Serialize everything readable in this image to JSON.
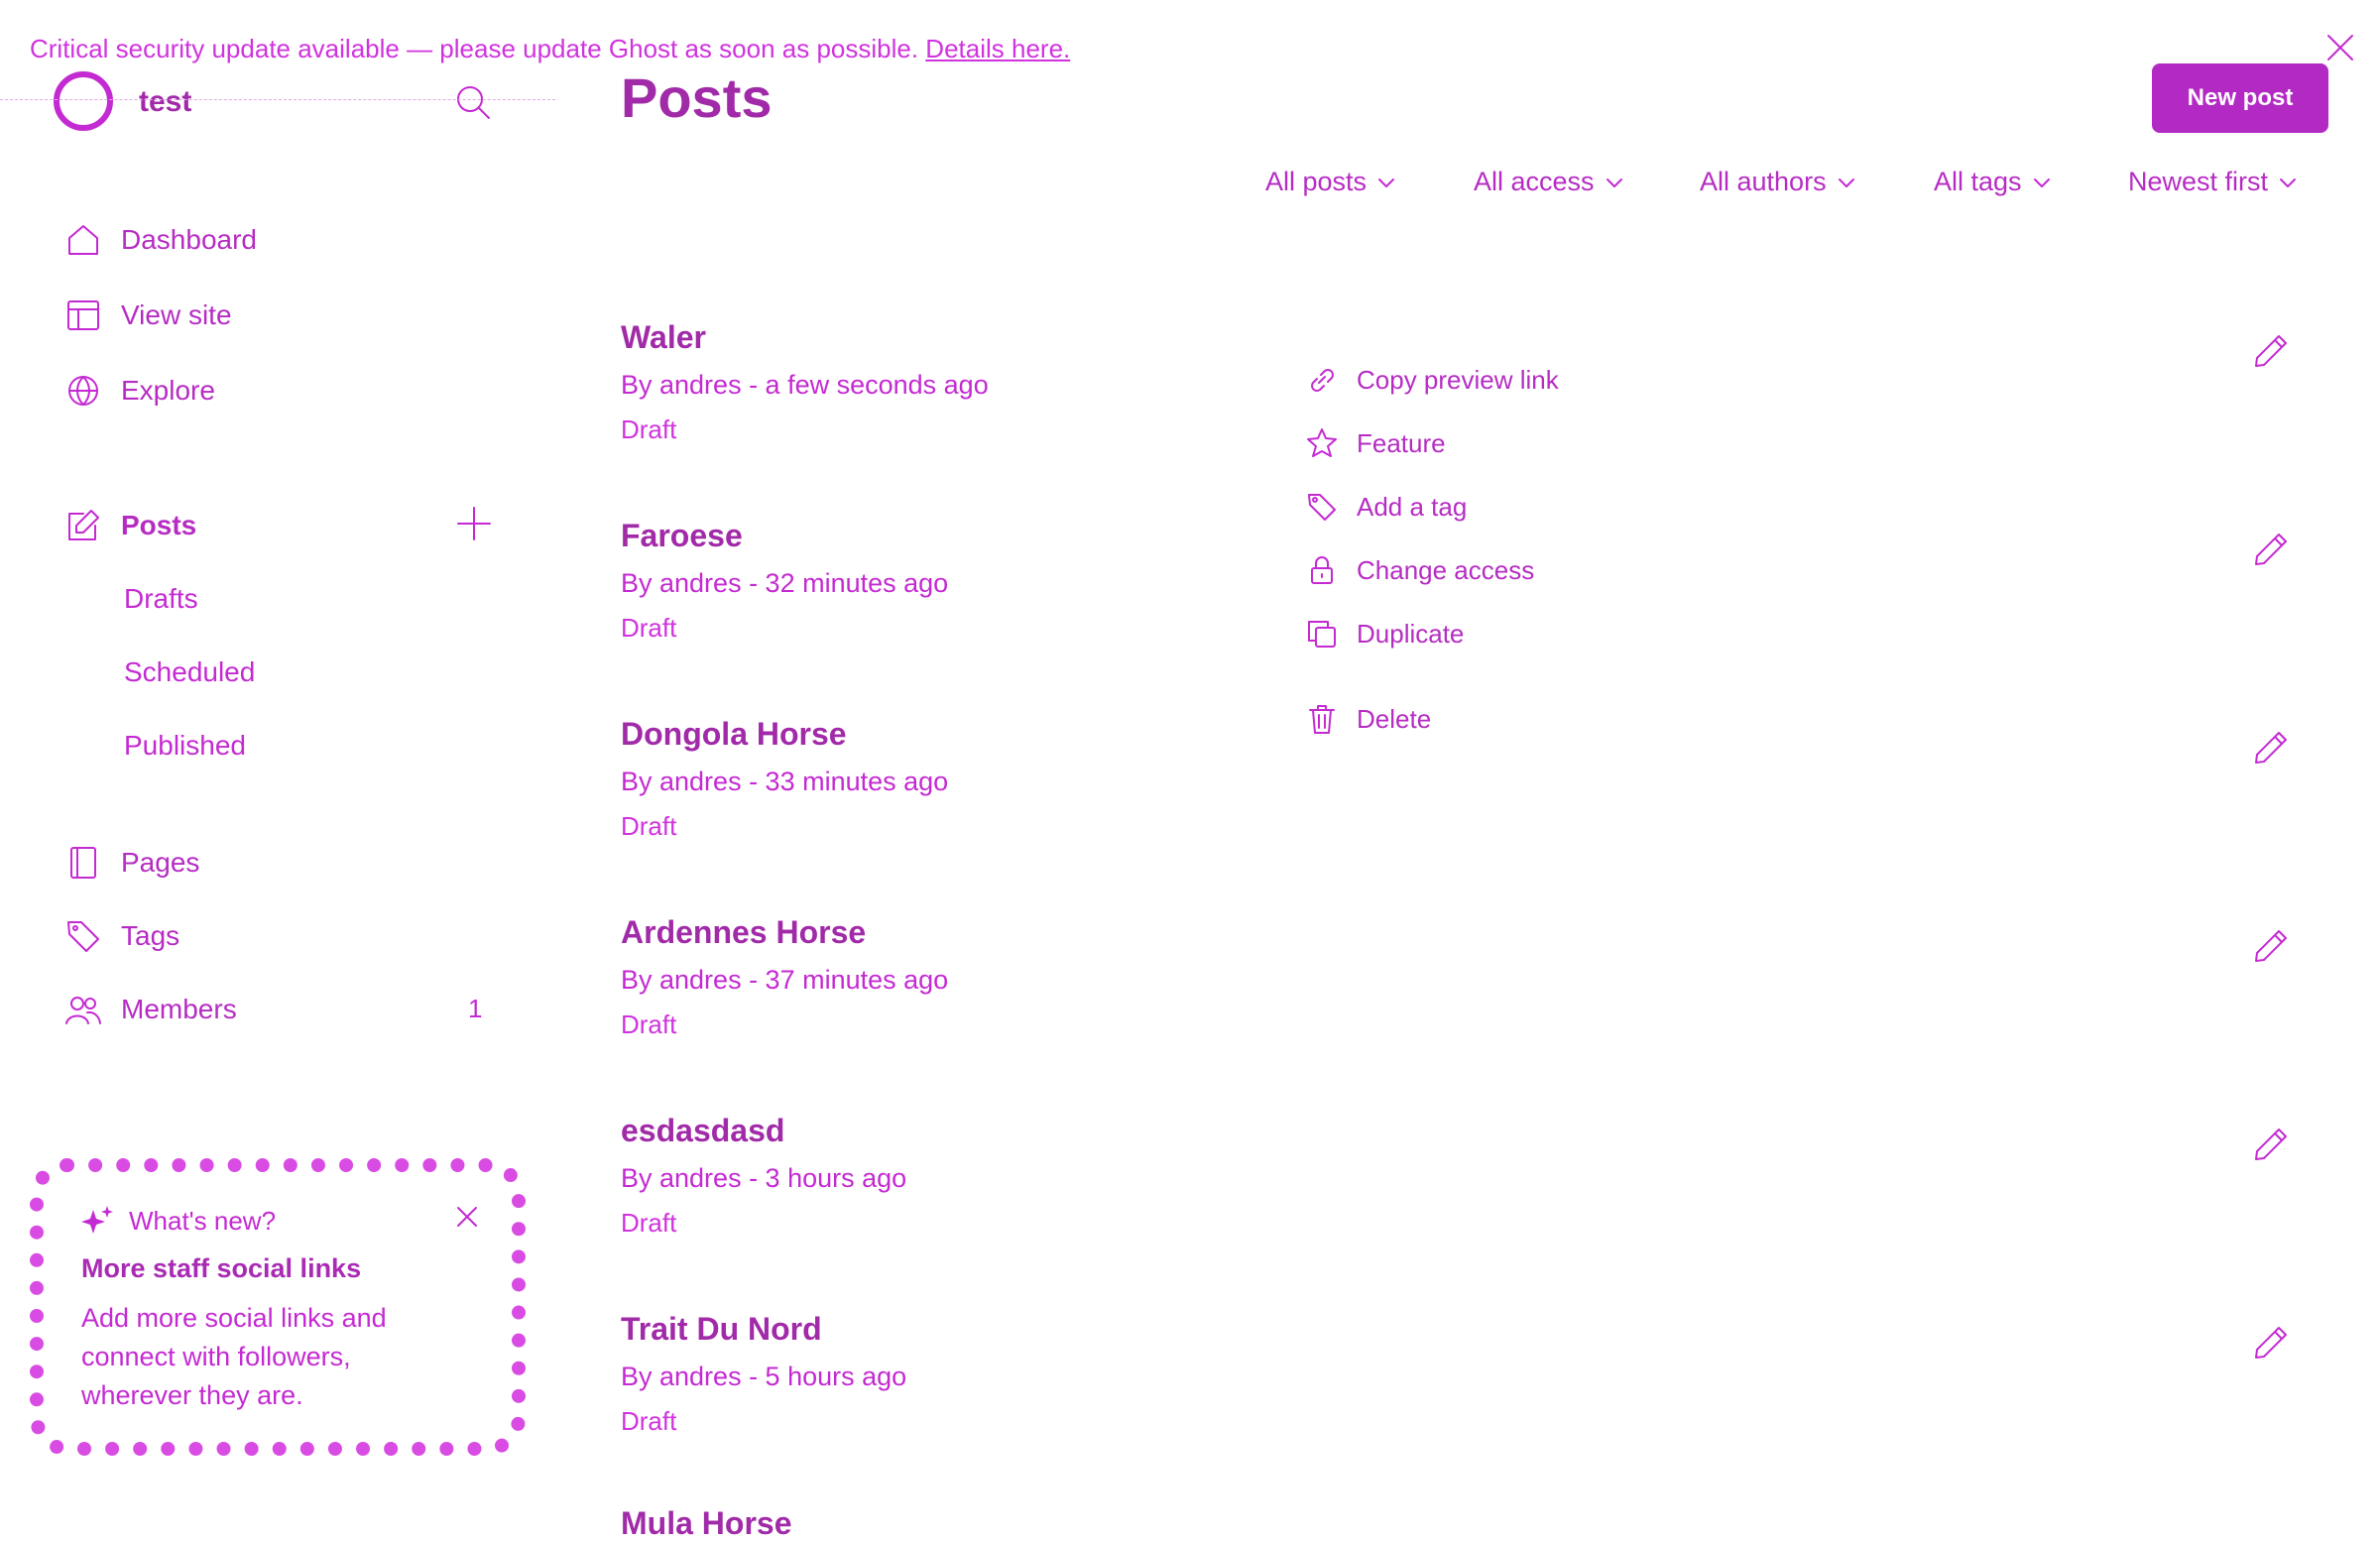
{
  "banner": {
    "message": "Critical security update available — please update Ghost as soon as possible.",
    "link": "Details here."
  },
  "site": {
    "name": "test"
  },
  "sidebar": {
    "items": [
      {
        "label": "Dashboard",
        "icon": "home-icon"
      },
      {
        "label": "View site",
        "icon": "layout-icon"
      },
      {
        "label": "Explore",
        "icon": "globe-icon"
      },
      {
        "label": "Posts",
        "icon": "edit-icon"
      },
      {
        "label": "Pages",
        "icon": "page-icon"
      },
      {
        "label": "Tags",
        "icon": "tag-icon"
      },
      {
        "label": "Members",
        "icon": "members-icon",
        "count": "1"
      }
    ],
    "post_subitems": [
      "Drafts",
      "Scheduled",
      "Published"
    ]
  },
  "whats_new": {
    "label": "What's new?",
    "title": "More staff social links",
    "body": "Add more social links and connect with followers, wherever they are."
  },
  "main": {
    "title": "Posts",
    "new_post_label": "New post",
    "filters": [
      "All posts",
      "All access",
      "All authors",
      "All tags",
      "Newest first"
    ],
    "posts": [
      {
        "title": "Waler",
        "meta": "By andres - a few seconds ago",
        "status": "Draft"
      },
      {
        "title": "Faroese",
        "meta": "By andres - 32 minutes ago",
        "status": "Draft"
      },
      {
        "title": "Dongola Horse",
        "meta": "By andres - 33 minutes ago",
        "status": "Draft"
      },
      {
        "title": "Ardennes Horse",
        "meta": "By andres - 37 minutes ago",
        "status": "Draft"
      },
      {
        "title": "esdasdasd",
        "meta": "By andres - 3 hours ago",
        "status": "Draft"
      },
      {
        "title": "Trait Du Nord",
        "meta": "By andres - 5 hours ago",
        "status": "Draft"
      },
      {
        "title": "Mula Horse",
        "meta": "",
        "status": ""
      }
    ]
  },
  "context_menu": {
    "items": [
      {
        "label": "Copy preview link",
        "icon": "link-icon"
      },
      {
        "label": "Feature",
        "icon": "star-icon"
      },
      {
        "label": "Add a tag",
        "icon": "tag-icon"
      },
      {
        "label": "Change access",
        "icon": "lock-icon"
      },
      {
        "label": "Duplicate",
        "icon": "duplicate-icon"
      },
      {
        "label": "Delete",
        "icon": "trash-icon"
      }
    ]
  },
  "colors": {
    "accent": "#c42ad2",
    "accent_dark": "#a12aa8",
    "button": "#b229c4"
  }
}
